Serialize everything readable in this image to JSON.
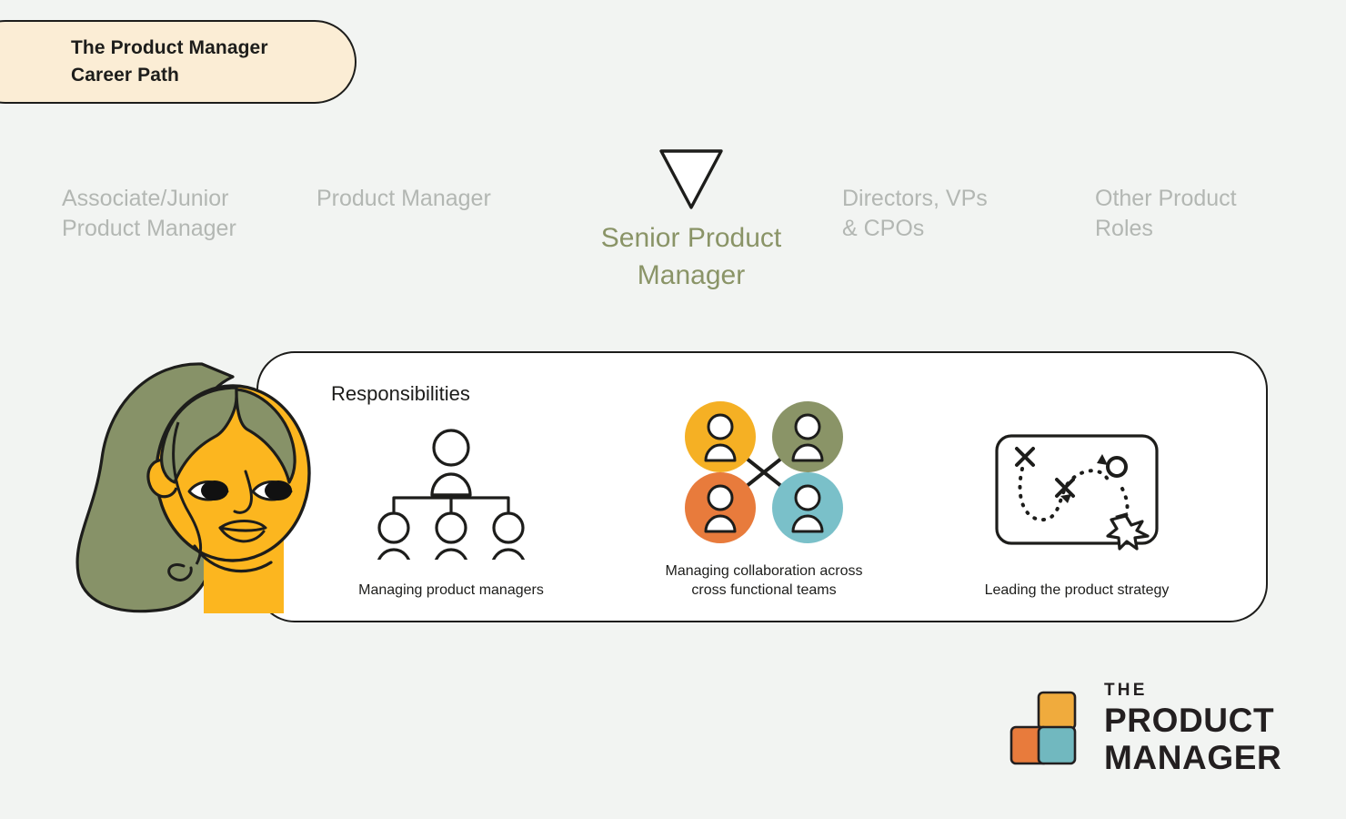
{
  "background_color": "#f2f4f2",
  "title_badge": {
    "text": "The Product Manager\nCareer Path",
    "background_color": "#fbedd5",
    "border_color": "#1d1d1b"
  },
  "career_path": {
    "active_index": 2,
    "inactive_color": "#b3b7b3",
    "active_color": "#8a9467",
    "marker_icon": "triangle-down-marker",
    "stages": [
      {
        "label": "Associate/Junior\nProduct Manager",
        "active": false
      },
      {
        "label": "Product Manager",
        "active": false
      },
      {
        "label": "Senior Product\nManager",
        "active": true
      },
      {
        "label": "Directors, VPs\n& CPOs",
        "active": false
      },
      {
        "label": "Other Product\nRoles",
        "active": false
      }
    ]
  },
  "responsibilities": {
    "heading": "Responsibilities",
    "card_background": "#ffffff",
    "card_border": "#1d1d1b",
    "items": [
      {
        "caption": "Managing product managers",
        "icon": "org-chart-icon"
      },
      {
        "caption": "Managing collaboration across\ncross functional teams",
        "icon": "four-people-circles-icon"
      },
      {
        "caption": "Leading the product strategy",
        "icon": "strategy-map-icon"
      }
    ],
    "circle_colors": {
      "top_left": "#f5b024",
      "top_right": "#8a9467",
      "bottom_left": "#e87b3c",
      "bottom_right": "#7ac0c9"
    }
  },
  "character": {
    "icon": "woman-avatar-illustration",
    "skin_color": "#fcb61f",
    "hair_color": "#879268",
    "line_color": "#1d1d1b"
  },
  "logo": {
    "line1": "THE",
    "line2": "PRODUCT",
    "line3": "MANAGER",
    "text_color": "#231f20",
    "block_orange": "#e87b3c",
    "block_yellow": "#f0ab3d",
    "block_teal": "#71b8bf"
  }
}
